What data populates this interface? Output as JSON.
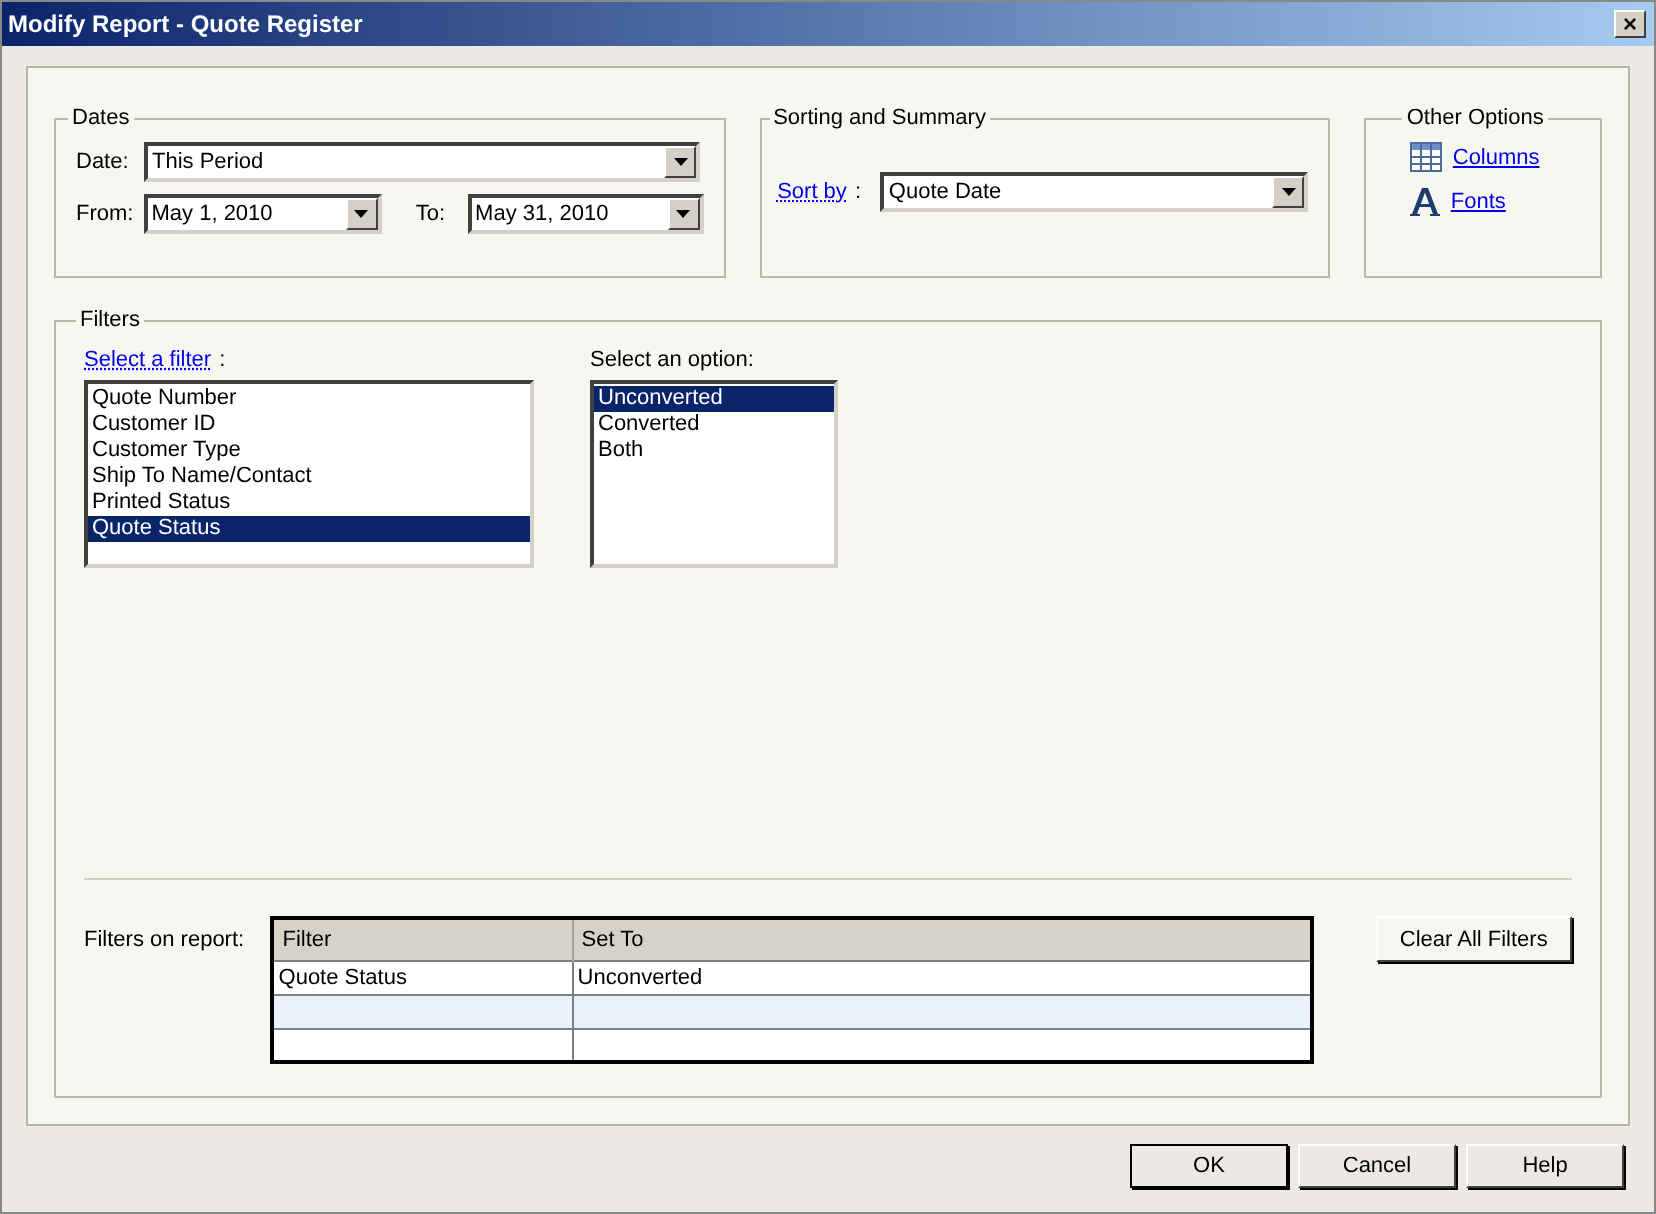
{
  "window": {
    "title": "Modify Report - Quote Register",
    "close": "×"
  },
  "dates": {
    "legend": "Dates",
    "date_label": "Date:",
    "date_value": "This Period",
    "from_label": "From:",
    "from_value": "May 1, 2010",
    "to_label": "To:",
    "to_value": "May 31, 2010"
  },
  "sorting": {
    "legend": "Sorting and Summary",
    "sort_label": "Sort by",
    "sort_colon": ":",
    "sort_value": "Quote Date"
  },
  "other_options": {
    "legend": "Other Options",
    "links": [
      {
        "kind": "columns",
        "label": "Columns"
      },
      {
        "kind": "fonts",
        "label": "Fonts"
      }
    ]
  },
  "filters": {
    "legend": "Filters",
    "filter_label": "Select a filter",
    "filter_colon": ":",
    "filter_items": [
      {
        "label": "Quote Number",
        "selected": false
      },
      {
        "label": "Customer ID",
        "selected": false
      },
      {
        "label": "Customer Type",
        "selected": false
      },
      {
        "label": "Ship To Name/Contact",
        "selected": false
      },
      {
        "label": "Printed Status",
        "selected": false
      },
      {
        "label": "Quote Status",
        "selected": true
      }
    ],
    "option_label": "Select an option:",
    "option_items": [
      {
        "label": "Unconverted",
        "selected": true
      },
      {
        "label": "Converted",
        "selected": false
      },
      {
        "label": "Both",
        "selected": false
      }
    ],
    "report_label": "Filters on report:",
    "table": {
      "columns": [
        "Filter",
        "Set To"
      ],
      "rows": [
        [
          "Quote Status",
          "Unconverted"
        ],
        [
          "",
          ""
        ],
        [
          "",
          ""
        ]
      ]
    },
    "clear_button": "Clear All Filters"
  },
  "buttons": [
    "OK",
    "Cancel",
    "Help"
  ]
}
